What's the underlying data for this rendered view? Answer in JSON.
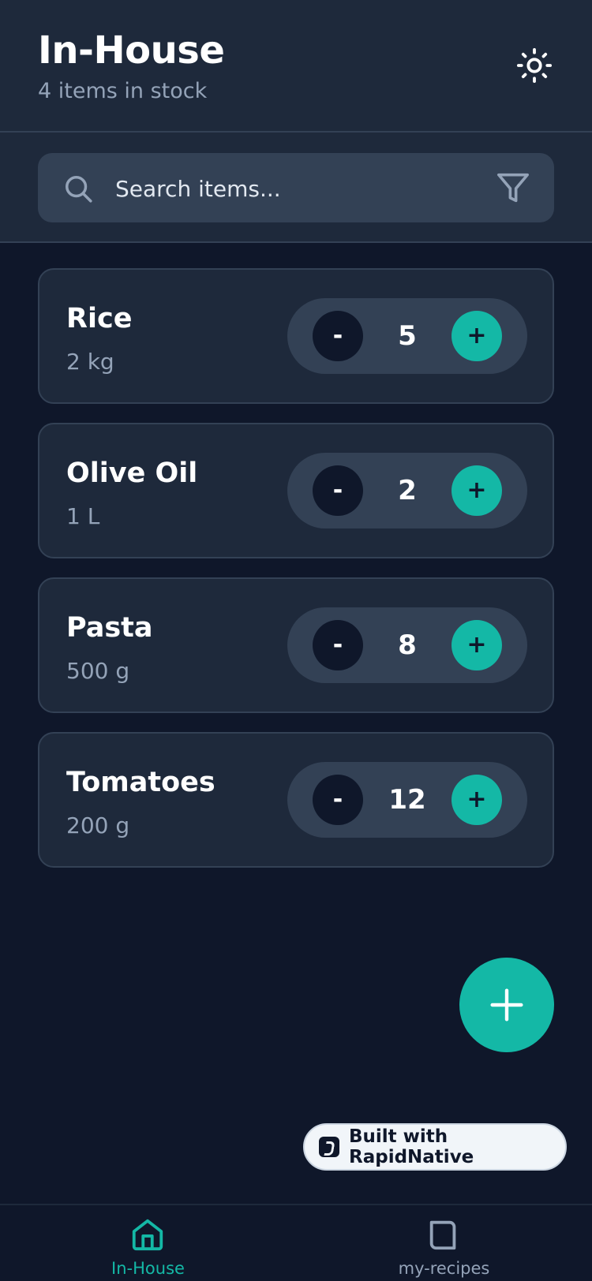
{
  "header": {
    "title": "In-House",
    "subtitle": "4 items in stock",
    "theme_icon": "sun-icon"
  },
  "search": {
    "placeholder": "Search items...",
    "search_icon": "search-icon",
    "filter_icon": "filter-icon"
  },
  "items": [
    {
      "name": "Rice",
      "size": "2 kg",
      "quantity": "5",
      "minus_label": "-",
      "plus_label": "+"
    },
    {
      "name": "Olive Oil",
      "size": "1 L",
      "quantity": "2",
      "minus_label": "-",
      "plus_label": "+"
    },
    {
      "name": "Pasta",
      "size": "500 g",
      "quantity": "8",
      "minus_label": "-",
      "plus_label": "+"
    },
    {
      "name": "Tomatoes",
      "size": "200 g",
      "quantity": "12",
      "minus_label": "-",
      "plus_label": "+"
    }
  ],
  "fab": {
    "icon": "plus-icon"
  },
  "badge": {
    "label": "Built with RapidNative"
  },
  "nav": {
    "items": [
      {
        "label": "In-House",
        "icon": "home-icon",
        "active": true
      },
      {
        "label": "my-recipes",
        "icon": "recipes-icon",
        "active": false
      }
    ]
  },
  "colors": {
    "background": "#0f172a",
    "surface": "#1e293b",
    "surface_raised": "#334155",
    "accent": "#14b8a6",
    "text_muted": "#94a3b8"
  }
}
